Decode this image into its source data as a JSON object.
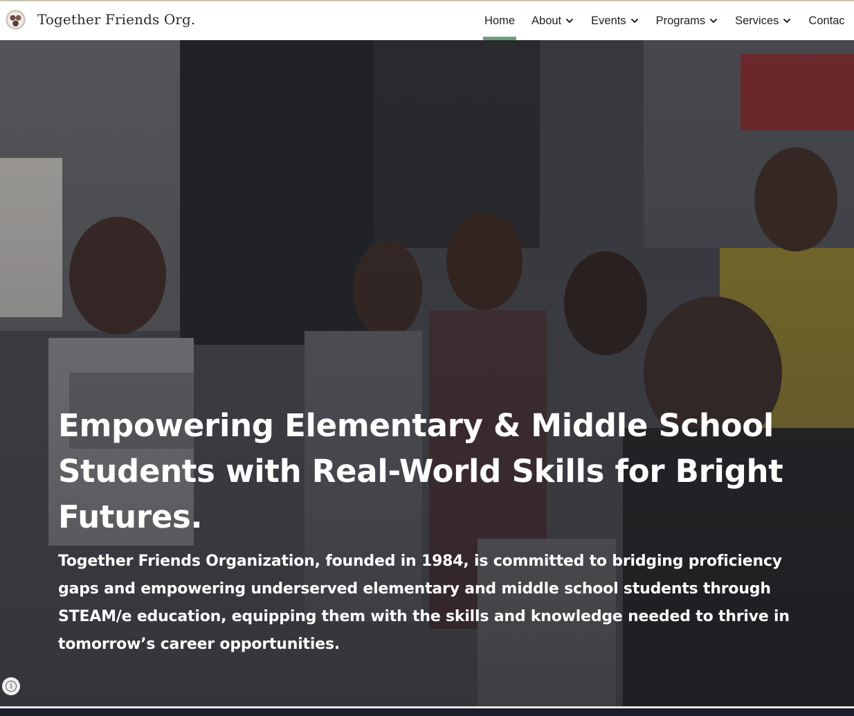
{
  "header": {
    "site_title": "Together Friends Org.",
    "logo_icon": "organization-logo-icon"
  },
  "nav": {
    "items": [
      {
        "label": "Home",
        "active": true,
        "has_dropdown": false
      },
      {
        "label": "About",
        "active": false,
        "has_dropdown": true
      },
      {
        "label": "Events",
        "active": false,
        "has_dropdown": true
      },
      {
        "label": "Programs",
        "active": false,
        "has_dropdown": true
      },
      {
        "label": "Services",
        "active": false,
        "has_dropdown": true
      },
      {
        "label": "Contac",
        "active": false,
        "has_dropdown": false
      }
    ],
    "active_color": "#6a9f79",
    "dropdown_icon": "chevron-down-icon"
  },
  "hero": {
    "heading": "Empowering Elementary & Middle School Students with Real-World Skills for Bright Futures.",
    "body": "Together Friends Organization, founded in 1984, is committed to bridging proficiency gaps and empowering underserved elementary and middle school students through STEAM/e education, equipping them with the skills and knowledge needed to thrive in tomorrow’s career opportunities.",
    "background_description_icon": "group-photo-students-image"
  },
  "info_button": {
    "icon": "info-icon",
    "label": "i"
  }
}
